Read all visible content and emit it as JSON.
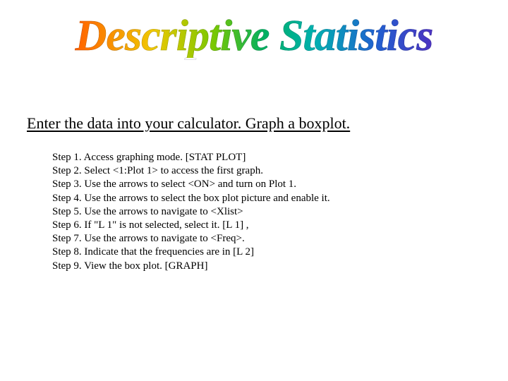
{
  "title": "Descriptive Statistics",
  "subtitle": "Enter the data into your calculator. Graph a boxplot.",
  "steps": [
    "Step 1. Access graphing mode. [STAT PLOT]",
    "Step 2. Select <1:Plot 1> to access the first graph.",
    "Step 3. Use the arrows to select <ON> and turn on Plot 1.",
    "Step 4. Use the arrows to select the box plot picture and enable it.",
    "Step 5. Use the arrows to navigate to <Xlist>",
    "Step 6. If \"L 1\" is not selected, select it. [L 1] ,",
    "Step 7. Use the arrows to navigate to <Freq>.",
    "Step 8. Indicate that the frequencies are in [L 2]",
    "Step 9. View the box plot. [GRAPH]"
  ]
}
